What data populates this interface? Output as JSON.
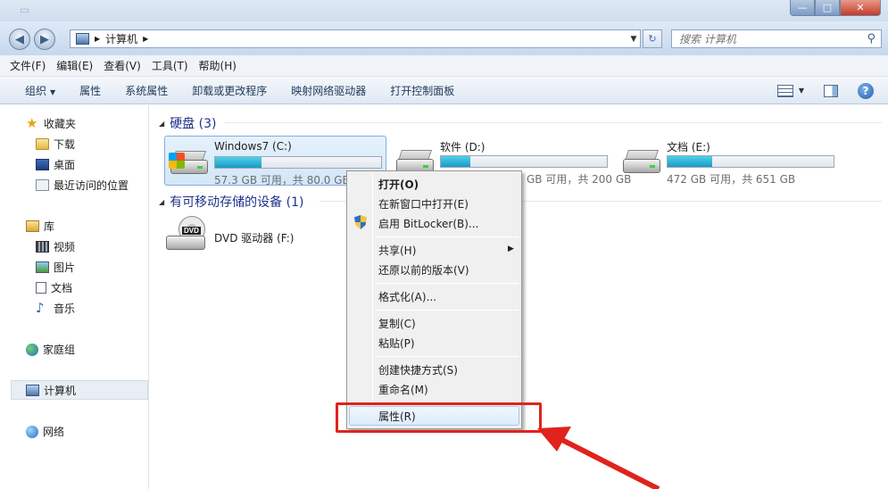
{
  "window": {
    "title": "计算机",
    "buttons": {
      "minimize": "—",
      "maximize": "□",
      "close": "✕"
    }
  },
  "address": {
    "path": [
      "计算机"
    ],
    "search_placeholder": "搜索 计算机"
  },
  "menubar": [
    "文件(F)",
    "编辑(E)",
    "查看(V)",
    "工具(T)",
    "帮助(H)"
  ],
  "commandbar": [
    "组织",
    "属性",
    "系统属性",
    "卸载或更改程序",
    "映射网络驱动器",
    "打开控制面板"
  ],
  "sidebar": {
    "favorites": {
      "label": "收藏夹",
      "items": [
        "下载",
        "桌面",
        "最近访问的位置"
      ]
    },
    "libraries": {
      "label": "库",
      "items": [
        "视频",
        "图片",
        "文档",
        "音乐"
      ]
    },
    "homegroup": "家庭组",
    "computer": "计算机",
    "network": "网络"
  },
  "groups": {
    "hard_disks": "硬盘 (3)",
    "removable": "有可移动存储的设备 (1)"
  },
  "drives": [
    {
      "name": "Windows7 (C:)",
      "info": "57.3 GB 可用，共 80.0 GB",
      "used_fraction": 0.28
    },
    {
      "name": "软件 (D:)",
      "info": "GB 可用，共 200 GB",
      "used_fraction": 0.18
    },
    {
      "name": "文档 (E:)",
      "info": "472 GB 可用，共 651 GB",
      "used_fraction": 0.27
    }
  ],
  "dvd": {
    "name": "DVD 驱动器 (F:)",
    "badge": "DVD"
  },
  "context_menu": {
    "open": "打开(O)",
    "open_new_window": "在新窗口中打开(E)",
    "bitlocker": "启用 BitLocker(B)...",
    "share": "共享(H)",
    "restore": "还原以前的版本(V)",
    "format": "格式化(A)...",
    "copy": "复制(C)",
    "paste": "粘贴(P)",
    "shortcut": "创建快捷方式(S)",
    "rename": "重命名(M)",
    "properties": "属性(R)"
  },
  "colors": {
    "annotation": "#e0231c",
    "group_header": "#1e3287",
    "drive_bar": "#1a9ac4"
  }
}
